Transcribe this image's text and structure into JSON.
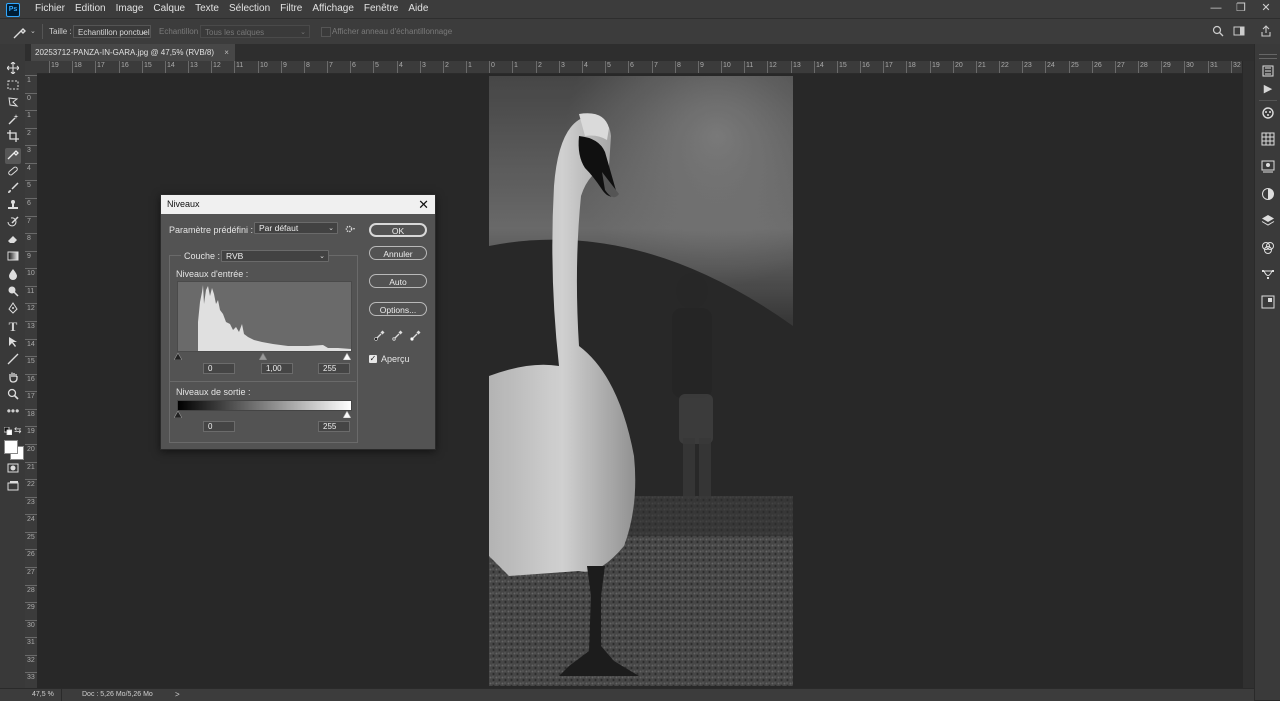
{
  "app": {
    "logo": "Ps",
    "menu": [
      "Fichier",
      "Edition",
      "Image",
      "Calque",
      "Texte",
      "Sélection",
      "Filtre",
      "Affichage",
      "Fenêtre",
      "Aide"
    ],
    "window_controls": {
      "minimize": "—",
      "restore": "❐",
      "close": "✕"
    }
  },
  "options_bar": {
    "tool_icon": "eyedropper-icon",
    "size_label": "Taille :",
    "size_value": "Echantillon ponctuel",
    "sample_label": "Echantillon :",
    "sample_value": "Tous les calques",
    "show_ring_label": "Afficher anneau d'échantillonnage"
  },
  "document": {
    "tab_title": "20253712-PANZA-IN-GARA.jpg @ 47,5% (RVB/8)",
    "tab_close": "×"
  },
  "rulers": {
    "h_labels": [
      "19",
      "18",
      "17",
      "16",
      "15",
      "14",
      "13",
      "12",
      "11",
      "10",
      "9",
      "8",
      "7",
      "6",
      "5",
      "4",
      "3",
      "2",
      "1",
      "0",
      "1",
      "2",
      "3",
      "4",
      "5",
      "6",
      "7",
      "8",
      "9",
      "10",
      "11",
      "12",
      "13",
      "14",
      "15",
      "16",
      "17",
      "18",
      "19",
      "20",
      "21",
      "22",
      "23",
      "24",
      "25",
      "26",
      "27",
      "28",
      "29",
      "30",
      "31",
      "32"
    ],
    "v_labels": [
      "1",
      "0",
      "1",
      "2",
      "3",
      "4",
      "5",
      "6",
      "7",
      "8",
      "9",
      "10",
      "11",
      "12",
      "13",
      "14",
      "15",
      "16",
      "17",
      "18",
      "19",
      "20",
      "21",
      "22",
      "23",
      "24",
      "25",
      "26",
      "27",
      "28",
      "29",
      "30",
      "31",
      "32",
      "33"
    ]
  },
  "status": {
    "zoom": "47,5 %",
    "doc_info": "Doc : 5,26 Mo/5,26 Mo",
    "arrow": ">"
  },
  "levels_dialog": {
    "title": "Niveaux",
    "close": "✕",
    "preset_label": "Paramètre prédéfini :",
    "preset_value": "Par défaut",
    "channel_label": "Couche :",
    "channel_value": "RVB",
    "input_label": "Niveaux d'entrée :",
    "input_black": "0",
    "input_gamma": "1,00",
    "input_white": "255",
    "output_label": "Niveaux de sortie :",
    "output_black": "0",
    "output_white": "255",
    "buttons": {
      "ok": "OK",
      "cancel": "Annuler",
      "auto": "Auto",
      "options": "Options..."
    },
    "preview_label": "Aperçu",
    "preview_checked": true
  },
  "colors": {
    "menubar": "#3c3c3c",
    "canvas_bg": "#282828",
    "dialog_bg": "#535353",
    "ps_blue": "#31a8ff"
  }
}
